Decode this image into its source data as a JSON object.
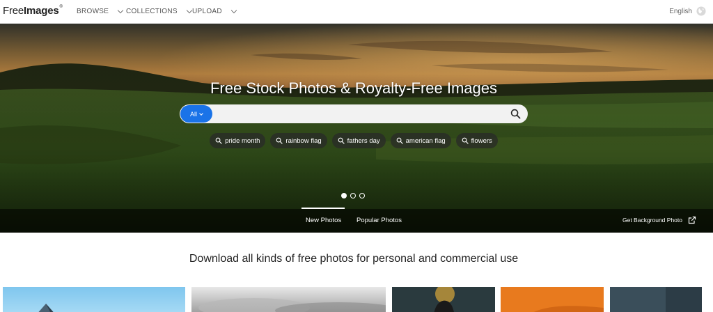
{
  "header": {
    "logo_free": "Free",
    "logo_images": "Images",
    "logo_mark": "®",
    "nav": [
      {
        "label": "BROWSE"
      },
      {
        "label": "COLLECTIONS"
      },
      {
        "label": "UPLOAD"
      }
    ],
    "language": "English",
    "icons": {
      "dropdown": "chevron-down-icon",
      "language": "globe-icon"
    }
  },
  "hero": {
    "title": "Free Stock Photos & Royalty-Free Images",
    "search": {
      "filter_label": "All",
      "placeholder": "",
      "value": "",
      "icon": "search-icon"
    },
    "tags": [
      {
        "label": "pride month"
      },
      {
        "label": "rainbow flag"
      },
      {
        "label": "fathers day"
      },
      {
        "label": "american flag"
      },
      {
        "label": "flowers"
      }
    ],
    "carousel": {
      "slides": 3,
      "active": 1
    },
    "tabs": [
      {
        "label": "New Photos",
        "active": true
      },
      {
        "label": "Popular Photos",
        "active": false
      }
    ],
    "background_link": "Get Background Photo",
    "background_link_icon": "external-link-icon"
  },
  "main": {
    "subtitle": "Download all kinds of free photos for personal and commercial use",
    "thumbnails": [
      {
        "name": "sky-tower-photo"
      },
      {
        "name": "cloudy-sky-photo"
      },
      {
        "name": "silhouette-photo"
      },
      {
        "name": "orange-photo"
      },
      {
        "name": "dark-blue-photo"
      }
    ]
  },
  "colors": {
    "accent": "#1a73e8",
    "nav_text": "#555555",
    "tag_bg": "#282828"
  }
}
